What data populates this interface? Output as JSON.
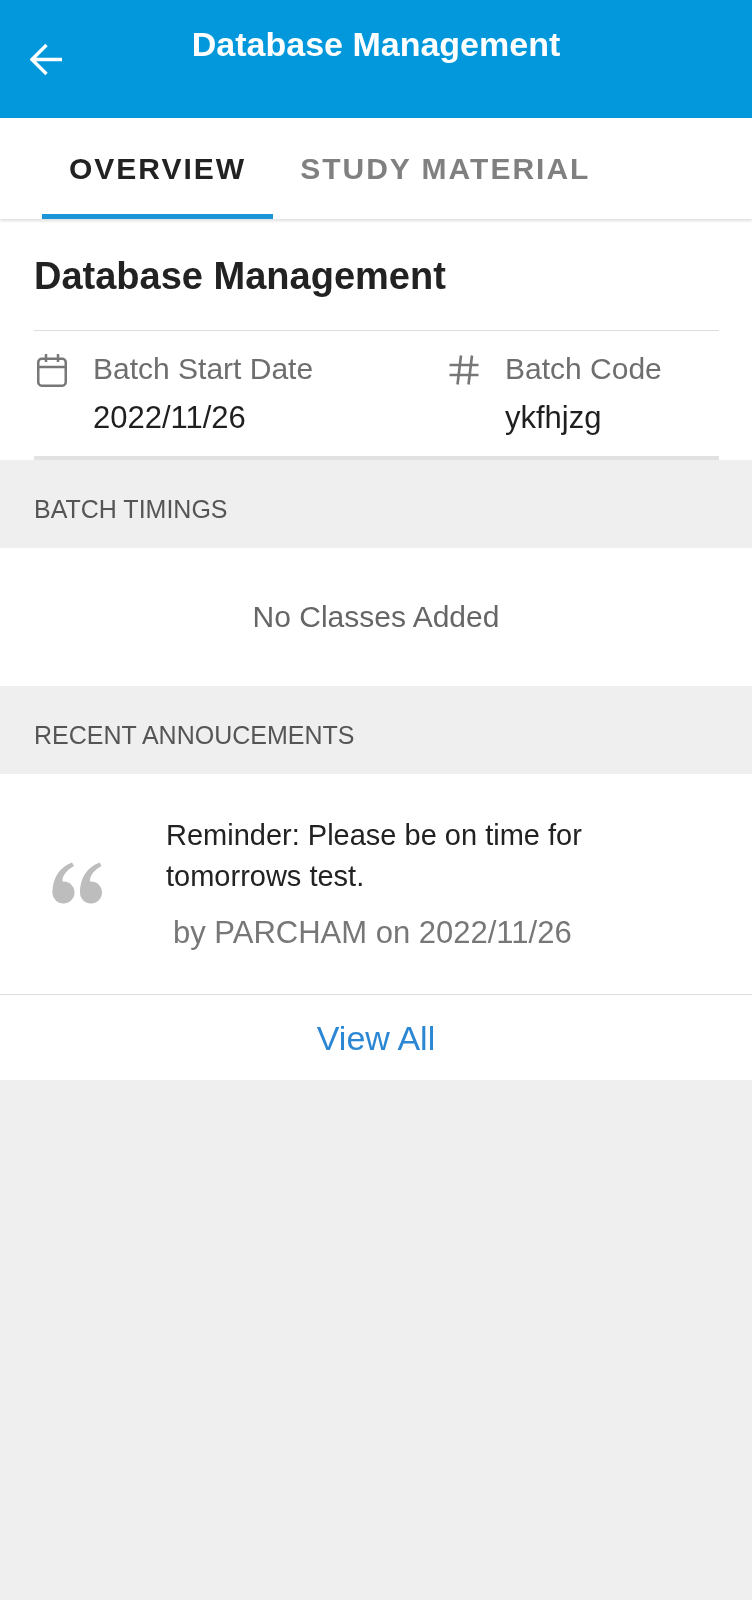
{
  "app_bar": {
    "title": "Database Management"
  },
  "tabs": [
    {
      "label": "OVERVIEW",
      "selected": true
    },
    {
      "label": "STUDY MATERIAL",
      "selected": false
    }
  ],
  "course": {
    "title": "Database Management",
    "details": [
      {
        "kind": "calendar",
        "label": "Batch Start Date",
        "value": "2022/11/26"
      },
      {
        "kind": "code",
        "label": "Batch Code",
        "value": "ykfhjzg"
      }
    ]
  },
  "batch_timings": {
    "heading": "BATCH TIMINGS",
    "empty_text": "No Classes Added"
  },
  "recent_announcements": {
    "heading": "RECENT ANNOUCEMENTS",
    "items": [
      {
        "text": "Reminder: Please be on time for tomorrows test.",
        "byline": "by PARCHAM on 2022/11/26"
      }
    ],
    "view_all": "View All"
  }
}
